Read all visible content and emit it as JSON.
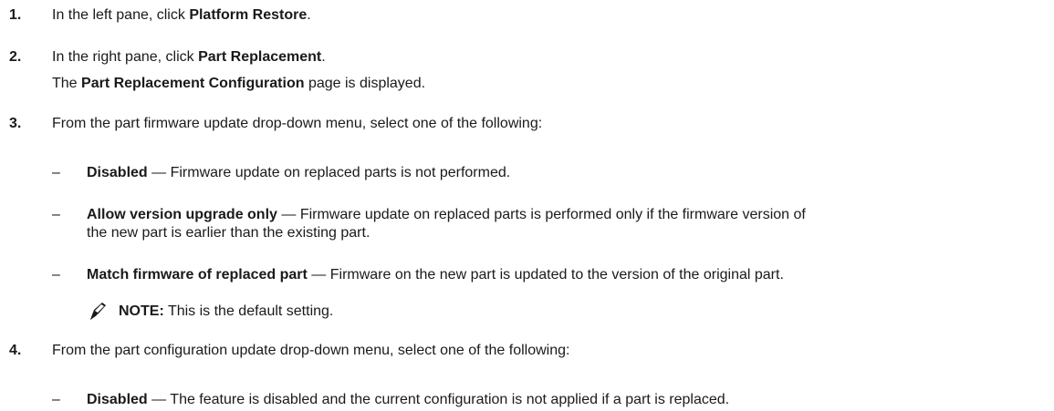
{
  "steps": [
    {
      "num": "1.",
      "pre": "In the left pane, click ",
      "bold": "Platform Restore",
      "post": "."
    },
    {
      "num": "2.",
      "pre": "In the right pane, click ",
      "bold": "Part Replacement",
      "post": ".",
      "result": {
        "pre": "The ",
        "bold": "Part Replacement Configuration",
        "post": " page is displayed."
      }
    },
    {
      "num": "3.",
      "text": "From the part firmware update drop-down menu, select one of the following:",
      "options": [
        {
          "dash": "–",
          "term": "Disabled",
          "desc": " — Firmware update on replaced parts is not performed."
        },
        {
          "dash": "–",
          "term": "Allow version upgrade only",
          "desc": " — Firmware update on replaced parts is performed only if the firmware version of",
          "desc2": "the new part is earlier than the existing part."
        },
        {
          "dash": "–",
          "term": "Match firmware of replaced part",
          "desc": " — Firmware on the new part is updated to the version of the original part."
        }
      ],
      "note": {
        "icon": "pencil-note-icon",
        "label": "NOTE:",
        "text": " This is the default setting."
      }
    },
    {
      "num": "4.",
      "text": "From the part configuration update drop-down menu, select one of the following:",
      "options": [
        {
          "dash": "–",
          "term": "Disabled",
          "desc": " — The feature is disabled and the current configuration is not applied if a part is replaced."
        }
      ]
    }
  ]
}
